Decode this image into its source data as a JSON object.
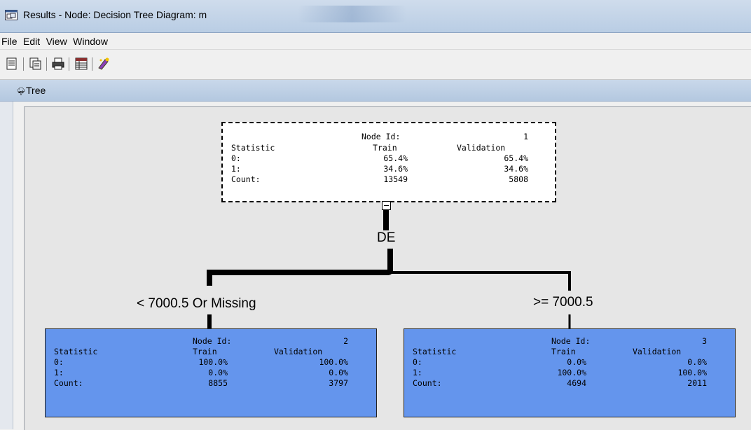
{
  "window": {
    "title": "Results - Node: Decision Tree  Diagram: m"
  },
  "menu": {
    "items": [
      {
        "label": "File"
      },
      {
        "label": "Edit"
      },
      {
        "label": "View"
      },
      {
        "label": "Window"
      }
    ]
  },
  "toolbar": {
    "buttons": [
      {
        "icon": "new-document-icon"
      },
      {
        "icon": "copy-icon"
      },
      {
        "icon": "print-icon"
      },
      {
        "icon": "table-icon"
      },
      {
        "icon": "wizard-icon"
      }
    ]
  },
  "pane": {
    "title": "Tree",
    "icon": "tree-icon"
  },
  "tree": {
    "split_variable": "DE",
    "root": {
      "node_id_label": "Node Id:",
      "node_id": "1",
      "stat_header": "Statistic",
      "train_header": "Train",
      "valid_header": "Validation",
      "rows": [
        {
          "label": "0:",
          "train": "65.4%",
          "valid": "65.4%"
        },
        {
          "label": "1:",
          "train": "34.6%",
          "valid": "34.6%"
        },
        {
          "label": "Count:",
          "train": "13549",
          "valid": "5808"
        }
      ]
    },
    "children": [
      {
        "branch_label": "< 7000.5 Or Missing",
        "node_id_label": "Node Id:",
        "node_id": "2",
        "stat_header": "Statistic",
        "train_header": "Train",
        "valid_header": "Validation",
        "rows": [
          {
            "label": "0:",
            "train": "100.0%",
            "valid": "100.0%"
          },
          {
            "label": "1:",
            "train": "0.0%",
            "valid": "0.0%"
          },
          {
            "label": "Count:",
            "train": "8855",
            "valid": "3797"
          }
        ]
      },
      {
        "branch_label": ">= 7000.5",
        "node_id_label": "Node Id:",
        "node_id": "3",
        "stat_header": "Statistic",
        "train_header": "Train",
        "valid_header": "Validation",
        "rows": [
          {
            "label": "0:",
            "train": "0.0%",
            "valid": "0.0%"
          },
          {
            "label": "1:",
            "train": "100.0%",
            "valid": "100.0%"
          },
          {
            "label": "Count:",
            "train": "4694",
            "valid": "2011"
          }
        ]
      }
    ],
    "colors": {
      "leaf_fill": "#6495ed",
      "root_fill": "#ffffff",
      "canvas": "#e6e6e6"
    }
  }
}
